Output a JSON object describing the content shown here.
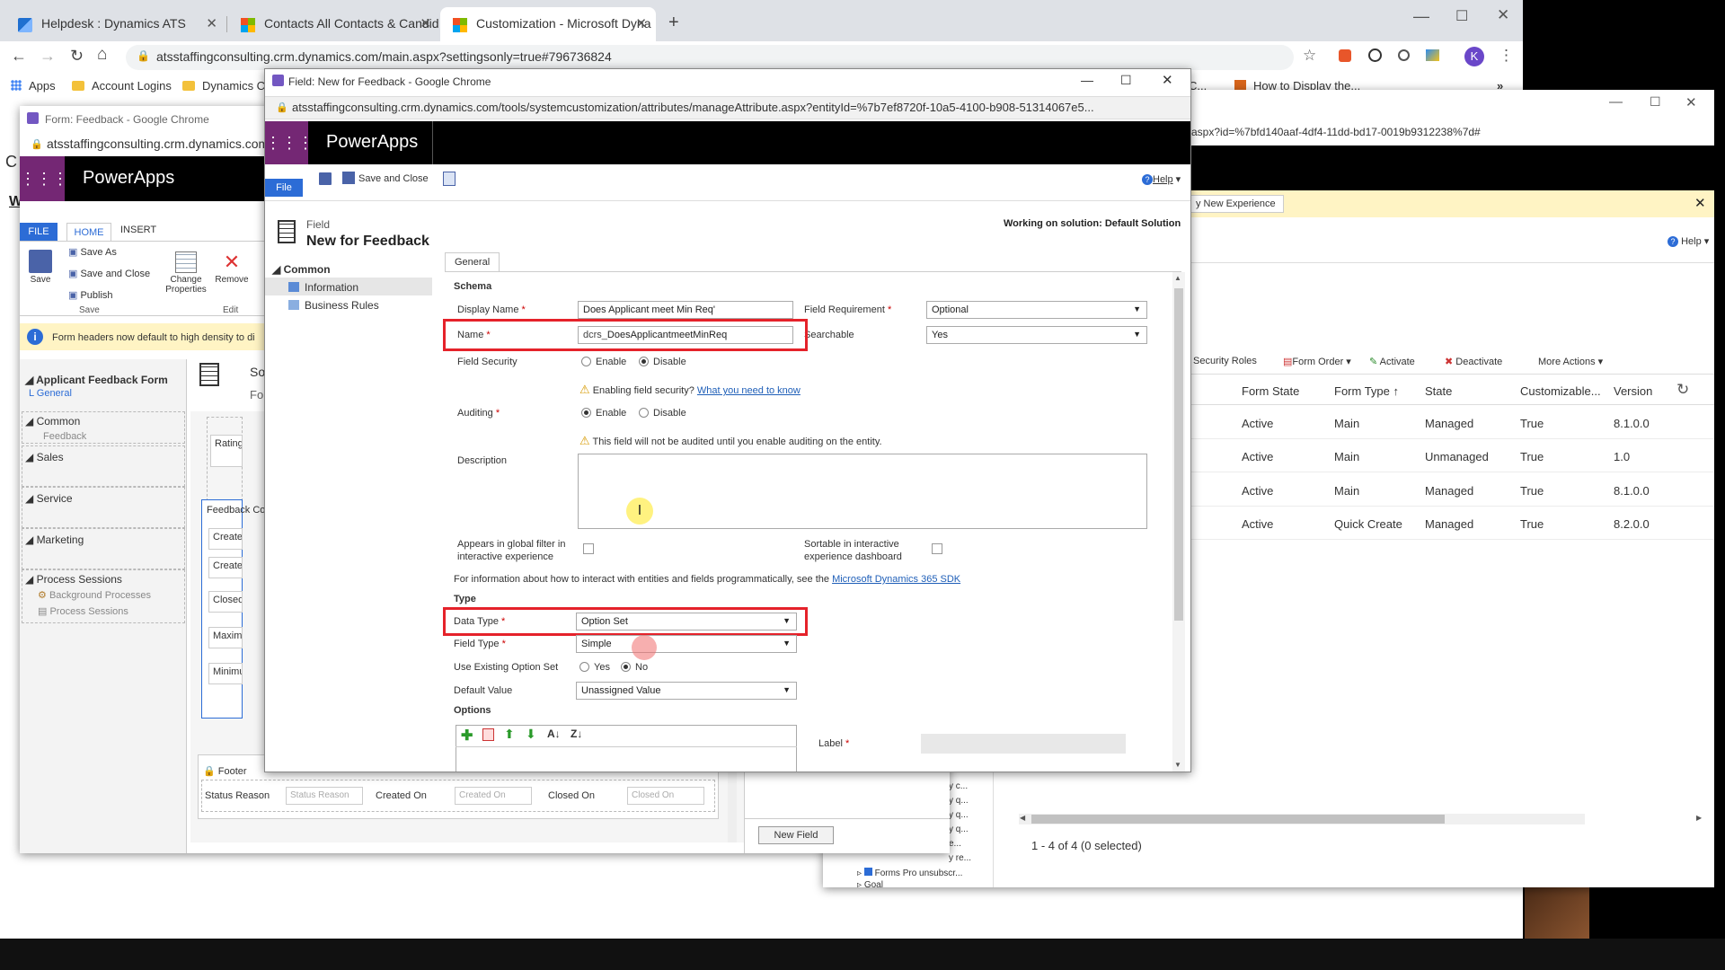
{
  "browser": {
    "tabs": [
      {
        "label": "Helpdesk : Dynamics ATS"
      },
      {
        "label": "Contacts All Contacts & Candid"
      },
      {
        "label": "Customization - Microsoft Dyna"
      }
    ],
    "url": "atsstaffingconsulting.crm.dynamics.com/main.aspx?settingsonly=true#796736824",
    "avatar_letter": "K",
    "bookmarks": [
      {
        "label": "Apps"
      },
      {
        "label": "Account Logins"
      },
      {
        "label": "Dynamics CR"
      },
      {
        "label": "C..."
      },
      {
        "label": "How to Display the..."
      }
    ]
  },
  "form_window": {
    "title": "Form: Feedback - Google Chrome",
    "url": "atsstaffingconsulting.crm.dynamics.com",
    "app_name": "PowerApps",
    "ribbon_tabs": [
      "FILE",
      "HOME",
      "INSERT"
    ],
    "ribbon": {
      "save": "Save",
      "save_as": "Save As",
      "save_close": "Save and Close",
      "publish": "Publish",
      "group_save": "Save",
      "change_properties": "Change Properties",
      "remove": "Remove",
      "group_edit": "Edit"
    },
    "info_bar": "Form headers now default to high density to di",
    "tree_title": "Applicant Feedback Form",
    "tree_general": "L General",
    "tree_sections": [
      {
        "label": "Common",
        "children": [
          "Feedback"
        ]
      },
      {
        "label": "Sales",
        "children": []
      },
      {
        "label": "Service",
        "children": []
      },
      {
        "label": "Marketing",
        "children": []
      },
      {
        "label": "Process Sessions",
        "children": [
          "Background Processes",
          "Process Sessions"
        ]
      }
    ],
    "header_so": "So",
    "header_fo": "Fo",
    "canvas_labels": [
      "Rating",
      "Feedback Co",
      "Created By",
      "Created By",
      "Closed By",
      "Maximum R",
      "Minimum R"
    ],
    "footer_label": "Footer",
    "footer_fields": [
      {
        "label": "Status Reason",
        "value": "Status Reason"
      },
      {
        "label": "Created On",
        "value": "Created On"
      },
      {
        "label": "Closed On",
        "value": "Closed On"
      }
    ],
    "new_field_button": "New Field"
  },
  "entity_window": {
    "url": "aspx?id=%7bfd140aaf-4df4-11dd-bd17-0019b9312238%7d#",
    "notification": "y New Experience",
    "help": "Help",
    "toolbar": [
      "Security Roles",
      "Form Order",
      "Activate",
      "Deactivate",
      "More Actions"
    ],
    "columns": [
      "Form State",
      "Form Type ↑",
      "State",
      "Customizable...",
      "Version"
    ],
    "rows": [
      [
        "Active",
        "Main",
        "Managed",
        "True",
        "8.1.0.0"
      ],
      [
        "Active",
        "Main",
        "Unmanaged",
        "True",
        "1.0"
      ],
      [
        "Active",
        "Main",
        "Managed",
        "True",
        "8.1.0.0"
      ],
      [
        "Active",
        "Quick Create",
        "Managed",
        "True",
        "8.2.0.0"
      ]
    ],
    "status": "1 - 4 of 4 (0 selected)",
    "tree_items": [
      "y c...",
      "y q...",
      "y q...",
      "y q...",
      "e...",
      "y re...",
      "Forms Pro unsubscr...",
      "Goal"
    ]
  },
  "field_window": {
    "title": "Field: New for Feedback - Google Chrome",
    "url": "atsstaffingconsulting.crm.dynamics.com/tools/systemcustomization/attributes/manageAttribute.aspx?entityId=%7b7ef8720f-10a5-4100-b908-51314067e5...",
    "app_name": "PowerApps",
    "save_close": "Save and Close",
    "help": "Help",
    "file_tab": "File",
    "header_kind": "Field",
    "header_title": "New for Feedback",
    "solution": "Working on solution: Default Solution",
    "nav_section": "Common",
    "nav_items": [
      "Information",
      "Business Rules"
    ],
    "tab_general": "General",
    "schema_heading": "Schema",
    "display_name_label": "Display Name",
    "display_name_value": "Does Applicant meet Min Req'",
    "name_label": "Name",
    "name_prefix": "dcrs_",
    "name_value": "DoesApplicantmeetMinReq",
    "field_requirement_label": "Field Requirement",
    "field_requirement_value": "Optional",
    "searchable_label": "Searchable",
    "searchable_value": "Yes",
    "field_security_label": "Field Security",
    "enable": "Enable",
    "disable": "Disable",
    "security_warning": "Enabling field security?",
    "security_link": "What you need to know",
    "auditing_label": "Auditing",
    "audit_warning": "This field will not be audited until you enable auditing on the entity.",
    "description_label": "Description",
    "global_filter_label": "Appears in global filter in interactive experience",
    "sortable_label": "Sortable in interactive experience dashboard",
    "sdk_text": "For information about how to interact with entities and fields programmatically, see the",
    "sdk_link": "Microsoft Dynamics 365 SDK",
    "type_heading": "Type",
    "data_type_label": "Data Type",
    "data_type_value": "Option Set",
    "field_type_label": "Field Type",
    "field_type_value": "Simple",
    "use_existing_label": "Use Existing Option Set",
    "yes": "Yes",
    "no": "No",
    "default_value_label": "Default Value",
    "default_value_value": "Unassigned Value",
    "options_heading": "Options",
    "label_label": "Label"
  }
}
